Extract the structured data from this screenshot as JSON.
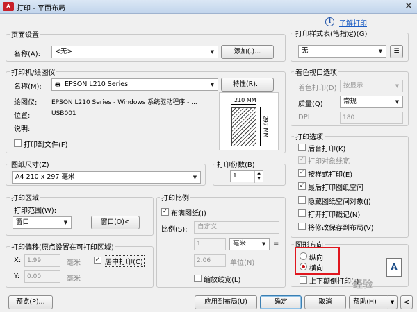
{
  "window": {
    "title": "打印 - 平面布局",
    "app_icon": "A",
    "help_link": "了解打印"
  },
  "page_setup": {
    "group": "页面设置",
    "name_label": "名称(A):",
    "name_value": "<无>",
    "add_button": "添加(.)..."
  },
  "plotter": {
    "group": "打印机/绘图仪",
    "name_label": "名称(M):",
    "name_value": "EPSON L210 Series",
    "properties_button": "特性(R)...",
    "plotter_label": "绘图仪:",
    "plotter_value": "EPSON L210 Series - Windows 系统驱动程序 - ...",
    "location_label": "位置:",
    "location_value": "USB001",
    "description_label": "说明:",
    "plot_to_file": "打印到文件(F)",
    "preview_width": "210 MM",
    "preview_height": "297 MM"
  },
  "paper_size": {
    "group": "图纸尺寸(Z)",
    "value": "A4 210 x 297 毫米"
  },
  "copies": {
    "label": "打印份数(B)",
    "value": "1"
  },
  "plot_area": {
    "group": "打印区域",
    "what_label": "打印范围(W):",
    "what_value": "窗口",
    "window_button": "窗口(O)<"
  },
  "plot_offset": {
    "group": "打印偏移(原点设置在可打印区域)",
    "x_label": "X:",
    "x_value": "1.99",
    "x_unit": "毫米",
    "y_label": "Y:",
    "y_value": "0.00",
    "y_unit": "毫米",
    "center": "居中打印(C)"
  },
  "plot_scale": {
    "group": "打印比例",
    "fit": "布满图纸(I)",
    "scale_label": "比例(S):",
    "scale_value": "自定义",
    "num_value": "1",
    "unit_value": "毫米",
    "eq_sign": "=",
    "den_value": "2.06",
    "den_unit": "单位(N)",
    "lineweights": "缩放线宽(L)"
  },
  "style_table": {
    "group": "打印样式表(笔指定)(G)",
    "value": "无"
  },
  "shaded": {
    "group": "着色视口选项",
    "shade_label": "着色打印(D)",
    "shade_value": "按显示",
    "quality_label": "质量(Q)",
    "quality_value": "常规",
    "dpi_label": "DPI",
    "dpi_value": "180"
  },
  "plot_options": {
    "group": "打印选项",
    "items": [
      {
        "label": "后台打印(K)",
        "mark": "",
        "enabled": true
      },
      {
        "label": "打印对象线宽",
        "mark": "✓",
        "enabled": false
      },
      {
        "label": "按样式打印(E)",
        "mark": "✓",
        "enabled": true
      },
      {
        "label": "最后打印图纸空间",
        "mark": "✓",
        "enabled": true
      },
      {
        "label": "隐藏图纸空间对象(J)",
        "mark": "",
        "enabled": true
      },
      {
        "label": "打开打印戳记(N)",
        "mark": "",
        "enabled": true
      },
      {
        "label": "将修改保存到布局(V)",
        "mark": "",
        "enabled": true
      }
    ]
  },
  "orientation": {
    "group": "图形方向",
    "portrait": "纵向",
    "landscape": "横向",
    "upside_down": "上下颠倒打印(-)",
    "preview_glyph": "A",
    "highlight_color": "#e0161e"
  },
  "footer": {
    "preview": "预览(P)...",
    "apply": "应用到布局(U)",
    "ok": "确定",
    "cancel": "取消",
    "help": "帮助(H)"
  },
  "watermark": "经验"
}
